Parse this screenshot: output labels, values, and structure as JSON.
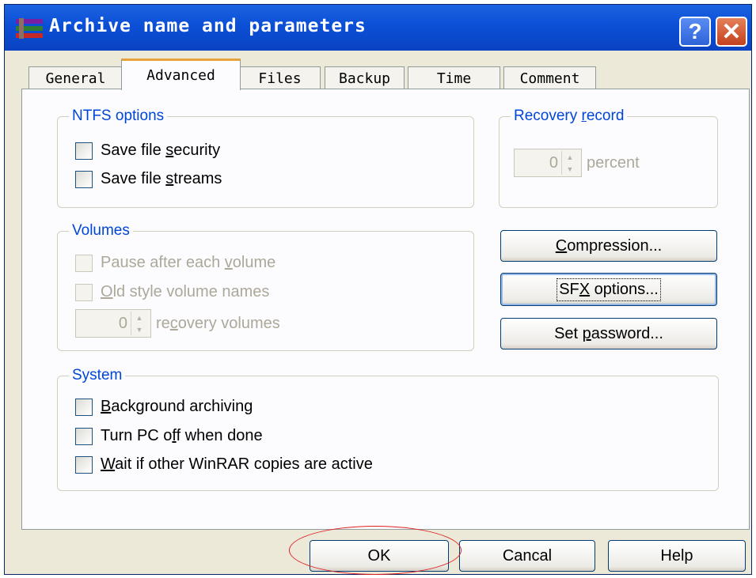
{
  "window": {
    "title": "Archive name and parameters",
    "title_bar_color": "#0b4fd6",
    "help_glyph": "?",
    "close_glyph": "✕"
  },
  "tabs": [
    {
      "label": "General"
    },
    {
      "label": "Advanced",
      "active": true
    },
    {
      "label": "Files"
    },
    {
      "label": "Backup"
    },
    {
      "label": "Time"
    },
    {
      "label": "Comment"
    }
  ],
  "ntfs": {
    "title": "NTFS options",
    "save_security": {
      "pre": "Save file ",
      "u": "s",
      "post": "ecurity",
      "checked": false
    },
    "save_streams": {
      "pre": "Save file ",
      "u": "s",
      "post": "treams",
      "checked": false
    }
  },
  "recovery": {
    "title_pre": "Recovery ",
    "title_u": "r",
    "title_post": "ecord",
    "value": "0",
    "unit": "percent"
  },
  "volumes": {
    "title": "Volumes",
    "pause": {
      "pre": "Pause after each ",
      "u": "v",
      "post": "olume",
      "checked": false
    },
    "old_style": {
      "pre": "",
      "u": "O",
      "post": "ld style volume names",
      "checked": false
    },
    "recovery_value": "0",
    "recovery_pre": "re",
    "recovery_u": "c",
    "recovery_post": "overy volumes"
  },
  "buttons": {
    "compression": {
      "pre": "",
      "u": "C",
      "post": "ompression..."
    },
    "sfx": {
      "pre": "SF",
      "u": "X",
      "post": " options..."
    },
    "password": {
      "pre": "Set ",
      "u": "p",
      "post": "assword..."
    },
    "ok": "OK",
    "cancel": "Cancal",
    "help": "Help"
  },
  "system": {
    "title": "System",
    "background": {
      "pre": "",
      "u": "B",
      "post": "ackground archiving",
      "checked": false
    },
    "turn_off": {
      "pre": "Turn PC o",
      "u": "f",
      "post": "f when done",
      "checked": false
    },
    "wait": {
      "pre": "",
      "u": "W",
      "post": "ait if other WinRAR copies are active",
      "checked": false
    }
  },
  "colors": {
    "group_title": "#0046d5",
    "disabled_text": "#aca899",
    "annotation_circle": "#e02020"
  }
}
